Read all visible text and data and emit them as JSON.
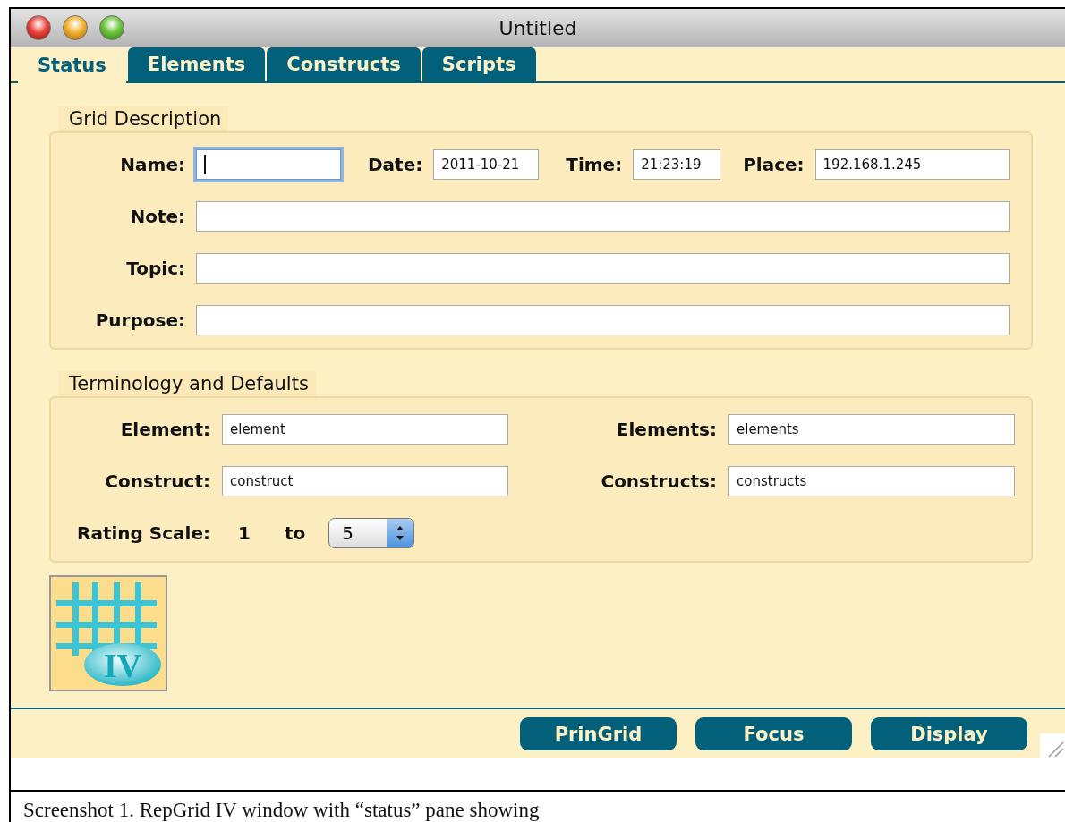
{
  "window": {
    "title": "Untitled"
  },
  "tabs": [
    {
      "label": "Status",
      "selected": true
    },
    {
      "label": "Elements",
      "selected": false
    },
    {
      "label": "Constructs",
      "selected": false
    },
    {
      "label": "Scripts",
      "selected": false
    }
  ],
  "grid_description": {
    "legend": "Grid Description",
    "rows": [
      [
        {
          "label": "Name:",
          "focused": true
        },
        {
          "label": "Date:",
          "value": "2011-10-21",
          "focused": false
        },
        {
          "label": "Time:",
          "value": "21:23:19",
          "focused": false
        },
        {
          "label": "Place:",
          "value": "192.168.1.245",
          "focused": false
        }
      ],
      [
        {
          "label": "Note:",
          "focused": false
        }
      ],
      [
        {
          "label": "Topic:",
          "focused": false
        }
      ],
      [
        {
          "label": "Purpose:",
          "focused": false
        }
      ]
    ]
  },
  "terminology": {
    "legend": "Terminology and Defaults",
    "fields": [
      {
        "label": "Element:",
        "value": "element"
      },
      {
        "label": "Elements:",
        "value": "elements"
      },
      {
        "label": "Construct:",
        "value": "construct"
      },
      {
        "label": "Constructs:",
        "value": "constructs"
      }
    ],
    "rating_scale": {
      "label": "Rating Scale:",
      "from": "1",
      "joiner": "to",
      "value": "5"
    }
  },
  "logo": {
    "text": "IV"
  },
  "buttons": [
    "PrinGrid",
    "Focus",
    "Display"
  ],
  "caption": "Screenshot 1. RepGrid IV window with “status” pane showing"
}
